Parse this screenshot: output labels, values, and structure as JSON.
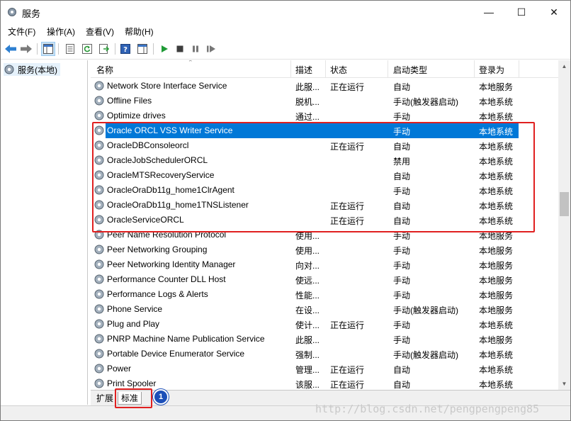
{
  "window": {
    "title": "服务",
    "controls": {
      "minimize": "—",
      "maximize": "☐",
      "close": "✕"
    }
  },
  "menu": [
    {
      "label": "文件(F)"
    },
    {
      "label": "操作(A)"
    },
    {
      "label": "查看(V)"
    },
    {
      "label": "帮助(H)"
    }
  ],
  "tree": {
    "root_label": "服务(本地)"
  },
  "columns": {
    "name": "名称",
    "description": "描述",
    "status": "状态",
    "startup": "启动类型",
    "logon": "登录为"
  },
  "services": [
    {
      "name": "Network Store Interface Service",
      "description": "此服...",
      "status": "正在运行",
      "startup": "自动",
      "logon": "本地服务"
    },
    {
      "name": "Offline Files",
      "description": "脱机...",
      "status": "",
      "startup": "手动(触发器启动)",
      "logon": "本地系统"
    },
    {
      "name": "Optimize drives",
      "description": "通过...",
      "status": "",
      "startup": "手动",
      "logon": "本地系统"
    },
    {
      "name": "Oracle ORCL VSS Writer Service",
      "description": "",
      "status": "",
      "startup": "手动",
      "logon": "本地系统"
    },
    {
      "name": "OracleDBConsoleorcl",
      "description": "",
      "status": "正在运行",
      "startup": "自动",
      "logon": "本地系统"
    },
    {
      "name": "OracleJobSchedulerORCL",
      "description": "",
      "status": "",
      "startup": "禁用",
      "logon": "本地系统"
    },
    {
      "name": "OracleMTSRecoveryService",
      "description": "",
      "status": "",
      "startup": "自动",
      "logon": "本地系统"
    },
    {
      "name": "OracleOraDb11g_home1ClrAgent",
      "description": "",
      "status": "",
      "startup": "手动",
      "logon": "本地系统"
    },
    {
      "name": "OracleOraDb11g_home1TNSListener",
      "description": "",
      "status": "正在运行",
      "startup": "自动",
      "logon": "本地系统"
    },
    {
      "name": "OracleServiceORCL",
      "description": "",
      "status": "正在运行",
      "startup": "自动",
      "logon": "本地系统"
    },
    {
      "name": "Peer Name Resolution Protocol",
      "description": "使用...",
      "status": "",
      "startup": "手动",
      "logon": "本地服务"
    },
    {
      "name": "Peer Networking Grouping",
      "description": "使用...",
      "status": "",
      "startup": "手动",
      "logon": "本地服务"
    },
    {
      "name": "Peer Networking Identity Manager",
      "description": "向对...",
      "status": "",
      "startup": "手动",
      "logon": "本地服务"
    },
    {
      "name": "Performance Counter DLL Host",
      "description": "使远...",
      "status": "",
      "startup": "手动",
      "logon": "本地服务"
    },
    {
      "name": "Performance Logs & Alerts",
      "description": "性能...",
      "status": "",
      "startup": "手动",
      "logon": "本地服务"
    },
    {
      "name": "Phone Service",
      "description": "在设...",
      "status": "",
      "startup": "手动(触发器启动)",
      "logon": "本地服务"
    },
    {
      "name": "Plug and Play",
      "description": "使计...",
      "status": "正在运行",
      "startup": "手动",
      "logon": "本地系统"
    },
    {
      "name": "PNRP Machine Name Publication Service",
      "description": "此服...",
      "status": "",
      "startup": "手动",
      "logon": "本地服务"
    },
    {
      "name": "Portable Device Enumerator Service",
      "description": "强制...",
      "status": "",
      "startup": "手动(触发器启动)",
      "logon": "本地系统"
    },
    {
      "name": "Power",
      "description": "管理...",
      "status": "正在运行",
      "startup": "自动",
      "logon": "本地系统"
    },
    {
      "name": "Print Spooler",
      "description": "该服...",
      "status": "正在运行",
      "startup": "自动",
      "logon": "本地系统"
    }
  ],
  "tabs": [
    {
      "label": "扩展"
    },
    {
      "label": "标准"
    }
  ],
  "annotation": {
    "badge": "1"
  },
  "watermark": "http://blog.csdn.net/pengpengpeng85",
  "colors": {
    "selection": "#0078d7",
    "highlight_box": "#e02020",
    "badge": "#1c4fb8"
  }
}
